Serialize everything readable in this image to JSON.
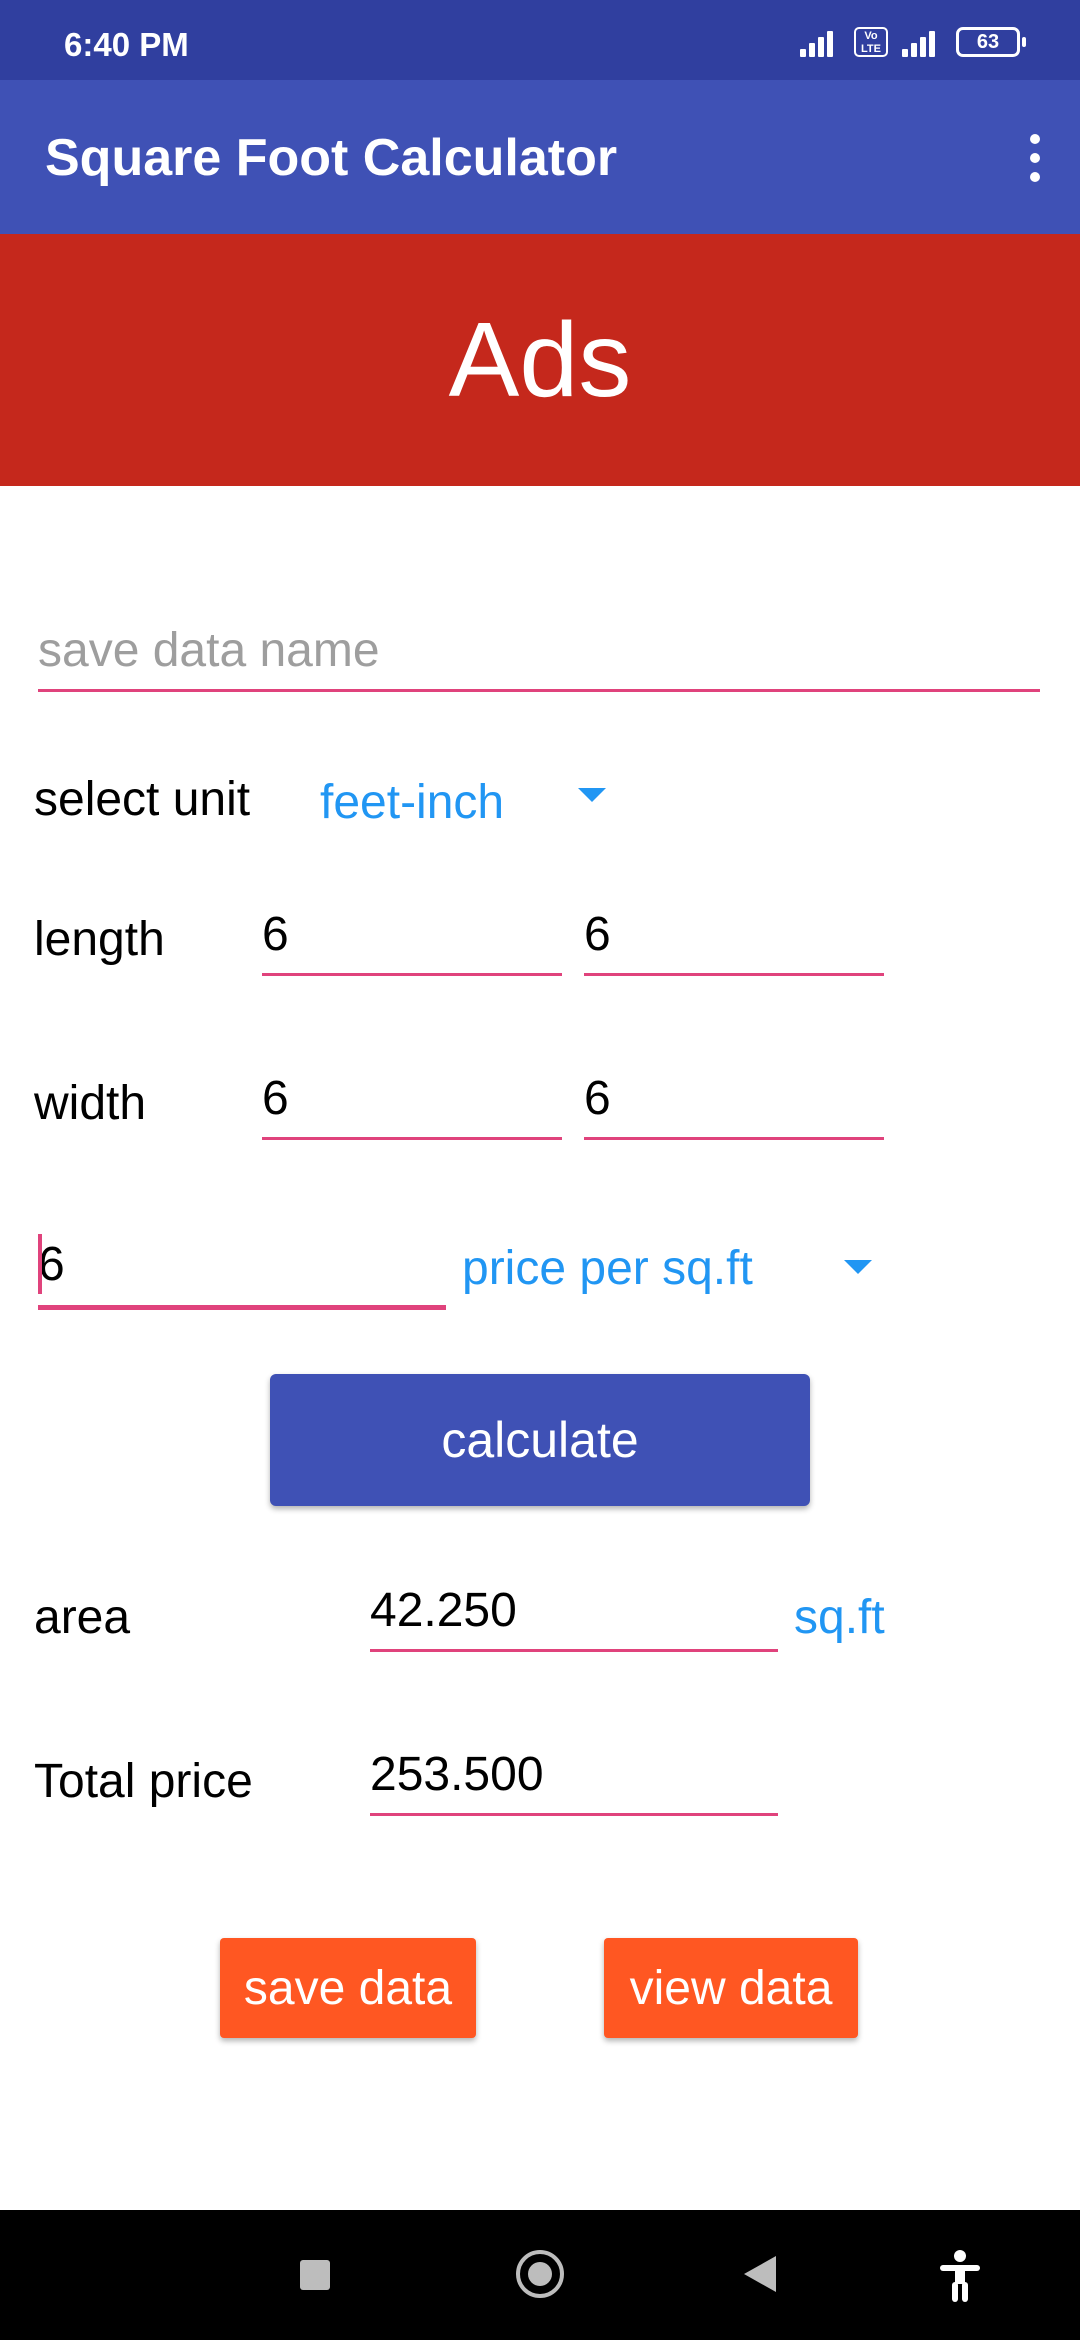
{
  "status_bar": {
    "time": "6:40 PM",
    "volte": "Vo LTE",
    "battery": "63"
  },
  "app_bar": {
    "title": "Square Foot Calculator",
    "menu_icon": "more-vert-icon"
  },
  "ads_banner": {
    "text": "Ads"
  },
  "form": {
    "save_name_placeholder": "save data name",
    "save_name_value": "",
    "select_unit_label": "select unit",
    "unit_selected": "feet-inch",
    "length_label": "length",
    "length_feet": "6",
    "length_inch": "6",
    "width_label": "width",
    "width_feet": "6",
    "width_inch": "6",
    "price_value": "6",
    "price_mode_selected": "price per sq.ft",
    "calculate_label": "calculate",
    "area_label": "area",
    "area_value": "42.250",
    "area_unit": "sq.ft",
    "total_price_label": "Total price",
    "total_price_value": "253.500",
    "save_data_label": "save data",
    "view_data_label": "view data"
  },
  "nav_bar": {
    "icons": [
      "recents-icon",
      "home-icon",
      "back-icon",
      "accessibility-icon"
    ]
  },
  "colors": {
    "status_bar": "#303f9f",
    "app_bar": "#3f51b5",
    "ads": "#c5281c",
    "accent_underline": "#e0437c",
    "spinner_text": "#2196f3",
    "orange_button": "#ff5722"
  }
}
